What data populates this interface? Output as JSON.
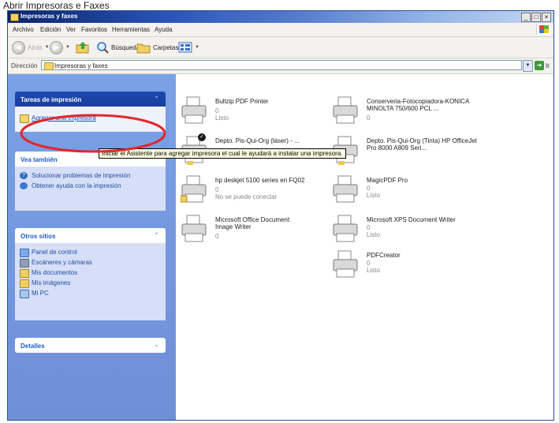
{
  "caption": "Abrir Impresoras e Faxes",
  "window": {
    "title": "Impresoras y faxes"
  },
  "menu": [
    "Archivo",
    "Edición",
    "Ver",
    "Favoritos",
    "Herramientas",
    "Ayuda"
  ],
  "toolbar": {
    "back": "Atrás",
    "search": "Búsqueda",
    "folders": "Carpetas"
  },
  "address": {
    "label": "Dirección",
    "value": "Impresoras y faxes",
    "go": "Ir"
  },
  "tasks": {
    "title": "Tareas de impresión",
    "items": [
      {
        "label": "Agregar una impresora"
      }
    ]
  },
  "see_also": {
    "title": "Vea también",
    "items": [
      {
        "label": "Solucionar problemas de impresión"
      },
      {
        "label": "Obtener ayuda con la impresión"
      }
    ]
  },
  "other_places": {
    "title": "Otros sitios",
    "items": [
      {
        "label": "Panel de control"
      },
      {
        "label": "Escáneres y cámaras"
      },
      {
        "label": "Mis documentos"
      },
      {
        "label": "Mis imágenes"
      },
      {
        "label": "Mi PC"
      }
    ]
  },
  "details": {
    "title": "Detalles"
  },
  "tooltip": "Iniciar el Asistente para agregar impresora el cual le ayudará a instalar una impresora.",
  "printers": [
    {
      "name": "Bullzip PDF Printer",
      "count": "0",
      "status": "Listo"
    },
    {
      "name": "Conserveria-Fotocopiadora-KONICA MINOLTA 750/600 PCL ...",
      "count": "0",
      "status": ""
    },
    {
      "name": "Depto. Pis-Qui-Org (láser) - ...",
      "count": "",
      "status": ""
    },
    {
      "name": "Depto. Pis-Qui-Org (Tinta) HP OfficeJet Pro 8000 A809 Seri...",
      "count": "",
      "status": ""
    },
    {
      "name": "hp deskjet 5100 series en FQ02",
      "count": "0",
      "status": "No se puede conectar"
    },
    {
      "name": "MagicPDF Pro",
      "count": "0",
      "status": "Listo"
    },
    {
      "name": "Microsoft Office Document Image Writer",
      "count": "0",
      "status": ""
    },
    {
      "name": "Microsoft XPS Document Writer",
      "count": "0",
      "status": "Listo"
    },
    {
      "name": "PDFCreator",
      "count": "0",
      "status": "Listo"
    }
  ],
  "colors": {
    "annotation": "#e3262b",
    "panel_link": "#1f4ea3",
    "side_bg": "#7aa1e6"
  }
}
